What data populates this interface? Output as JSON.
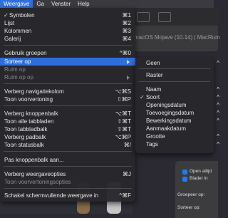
{
  "menubar": {
    "items": [
      "Weergave",
      "Ga",
      "Venster",
      "Help"
    ]
  },
  "view_menu": [
    {
      "label": "Symbolen",
      "shortcut": "⌘1",
      "checked": true
    },
    {
      "label": "Lijst",
      "shortcut": "⌘2"
    },
    {
      "label": "Kolommen",
      "shortcut": "⌘3"
    },
    {
      "label": "Galerij",
      "shortcut": "⌘4"
    },
    {
      "label": "Gebruik groepen",
      "shortcut": "^⌘0"
    },
    {
      "label": "Sorteer op",
      "submenu": true
    },
    {
      "label": "Ruim op",
      "disabled": true
    },
    {
      "label": "Ruim op op",
      "disabled": true,
      "submenu": true
    },
    {
      "label": "Verberg navigatiekolom",
      "shortcut": "⌥⌘S"
    },
    {
      "label": "Toon voorvertoning",
      "shortcut": "⇧⌘P"
    },
    {
      "label": "Verberg knoppenbalk",
      "shortcut": "⌥⌘T"
    },
    {
      "label": "Toon alle tabbladen",
      "shortcut": "⇧⌘T"
    },
    {
      "label": "Toon tabbladbalk",
      "shortcut": "⇧⌘T"
    },
    {
      "label": "Verberg padbalk",
      "shortcut": "⌥⌘P"
    },
    {
      "label": "Toon statusbalk",
      "shortcut": "⌘/"
    },
    {
      "label": "Pas knoppenbalk aan..."
    },
    {
      "label": "Verberg weergaveopties",
      "shortcut": "⌘J"
    },
    {
      "label": "Toon voorvertoningsopties",
      "disabled": true
    },
    {
      "label": "Schakel schermvullende weergave in",
      "shortcut": "^⌘F"
    }
  ],
  "sort_menu": [
    {
      "label": "Geen",
      "shortcut": "^"
    },
    {
      "label": "Raster"
    },
    {
      "label": "Naam",
      "shortcut": "^"
    },
    {
      "label": "Soort",
      "shortcut": "^",
      "checked": true
    },
    {
      "label": "Openingsdatum",
      "shortcut": "^"
    },
    {
      "label": "Toevoegingsdatum",
      "shortcut": "^"
    },
    {
      "label": "Bewerkingsdatum",
      "shortcut": "^"
    },
    {
      "label": "Aanmaakdatum"
    },
    {
      "label": "Grootte",
      "shortcut": "^"
    },
    {
      "label": "Tags",
      "shortcut": "^"
    }
  ],
  "background": {
    "window_title": "macOS Mojave (10.14) | MacRum",
    "prefs": {
      "open_label": "Open altijd",
      "browse_label": "Blader in",
      "group_label": "Groepeer op:",
      "sort_label": "Sorteer op:"
    }
  },
  "colors": {
    "highlight": "#2f6fdd",
    "menu_bg": "#28282c"
  }
}
